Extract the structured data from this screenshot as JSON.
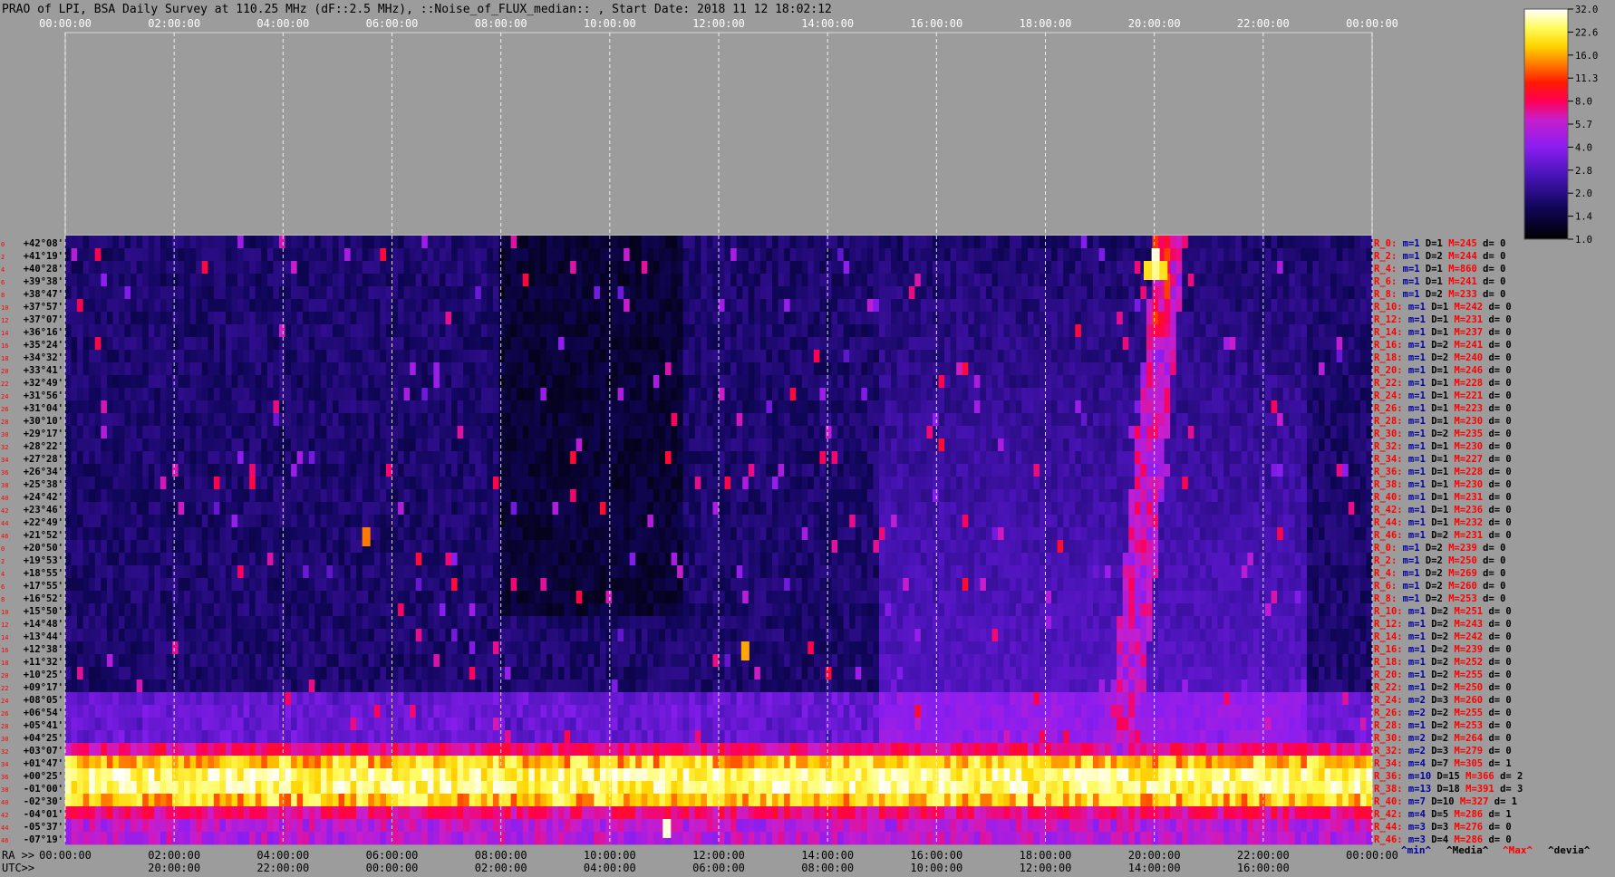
{
  "chart_data": {
    "type": "heatmap",
    "title": "PRAO of LPI, BSA Daily Survey at 110.25 MHz (dF::2.5 MHz), ::Noise_of_FLUX_median:: , Start Date: 2018 11 12 18:02:12",
    "x_top_ticks": [
      "00:00:00",
      "02:00:00",
      "04:00:00",
      "06:00:00",
      "08:00:00",
      "10:00:00",
      "12:00:00",
      "14:00:00",
      "16:00:00",
      "18:00:00",
      "20:00:00",
      "22:00:00",
      "00:00:00"
    ],
    "x_ra_label": "RA >>",
    "x_ra_ticks": [
      "00:00:00",
      "02:00:00",
      "04:00:00",
      "06:00:00",
      "08:00:00",
      "10:00:00",
      "12:00:00",
      "14:00:00",
      "16:00:00",
      "18:00:00",
      "20:00:00",
      "22:00:00",
      "00:00:00"
    ],
    "x_utc_label": "UTC>>",
    "x_utc_ticks": [
      "20:00:00",
      "22:00:00",
      "00:00:00",
      "02:00:00",
      "04:00:00",
      "06:00:00",
      "08:00:00",
      "10:00:00",
      "12:00:00",
      "14:00:00",
      "16:00:00"
    ],
    "y_left_ticks": [
      "+42°08'",
      "+41°19'",
      "+40°28'",
      "+39°38'",
      "+38°47'",
      "+37°57'",
      "+37°07'",
      "+36°16'",
      "+35°24'",
      "+34°32'",
      "+33°41'",
      "+32°49'",
      "+31°56'",
      "+31°04'",
      "+30°10'",
      "+29°17'",
      "+28°22'",
      "+27°28'",
      "+26°34'",
      "+25°38'",
      "+24°42'",
      "+23°46'",
      "+22°49'",
      "+21°52'",
      "+20°50'",
      "+19°53'",
      "+18°55'",
      "+17°55'",
      "+16°52'",
      "+15°50'",
      "+14°48'",
      "+13°44'",
      "+12°38'",
      "+11°32'",
      "+10°25'",
      "+09°17'",
      "+08°05'",
      "+06°54'",
      "+05°41'",
      "+04°25'",
      "+03°07'",
      "+01°47'",
      "+00°25'",
      "-01°00'",
      "-02°30'",
      "-04°01'",
      "-05°37'",
      "-07°19'"
    ],
    "y_ray_numbers": [
      "0",
      "2",
      "4",
      "6",
      "8",
      "10",
      "12",
      "14",
      "16",
      "18",
      "20",
      "22",
      "24",
      "26",
      "28",
      "30",
      "32",
      "34",
      "36",
      "38",
      "40",
      "42",
      "44",
      "46",
      "0",
      "2",
      "4",
      "6",
      "8",
      "10",
      "12",
      "14",
      "16",
      "18",
      "20",
      "22",
      "24",
      "26",
      "28",
      "30",
      "32",
      "34",
      "36",
      "38",
      "40",
      "42",
      "44",
      "46"
    ],
    "right_stats": [
      {
        "ray": "R_0:",
        "m": "m=1",
        "D": "D=1",
        "M": "M=245",
        "d": "d= 0"
      },
      {
        "ray": "R_2:",
        "m": "m=1",
        "D": "D=2",
        "M": "M=244",
        "d": "d= 0"
      },
      {
        "ray": "R_4:",
        "m": "m=1",
        "D": "D=1",
        "M": "M=860",
        "d": "d= 0"
      },
      {
        "ray": "R_6:",
        "m": "m=1",
        "D": "D=1",
        "M": "M=241",
        "d": "d= 0"
      },
      {
        "ray": "R_8:",
        "m": "m=1",
        "D": "D=2",
        "M": "M=233",
        "d": "d= 0"
      },
      {
        "ray": "R_10:",
        "m": "m=1",
        "D": "D=1",
        "M": "M=242",
        "d": "d= 0"
      },
      {
        "ray": "R_12:",
        "m": "m=1",
        "D": "D=1",
        "M": "M=231",
        "d": "d= 0"
      },
      {
        "ray": "R_14:",
        "m": "m=1",
        "D": "D=1",
        "M": "M=237",
        "d": "d= 0"
      },
      {
        "ray": "R_16:",
        "m": "m=1",
        "D": "D=2",
        "M": "M=241",
        "d": "d= 0"
      },
      {
        "ray": "R_18:",
        "m": "m=1",
        "D": "D=2",
        "M": "M=240",
        "d": "d= 0"
      },
      {
        "ray": "R_20:",
        "m": "m=1",
        "D": "D=1",
        "M": "M=246",
        "d": "d= 0"
      },
      {
        "ray": "R_22:",
        "m": "m=1",
        "D": "D=1",
        "M": "M=228",
        "d": "d= 0"
      },
      {
        "ray": "R_24:",
        "m": "m=1",
        "D": "D=1",
        "M": "M=221",
        "d": "d= 0"
      },
      {
        "ray": "R_26:",
        "m": "m=1",
        "D": "D=1",
        "M": "M=223",
        "d": "d= 0"
      },
      {
        "ray": "R_28:",
        "m": "m=1",
        "D": "D=1",
        "M": "M=230",
        "d": "d= 0"
      },
      {
        "ray": "R_30:",
        "m": "m=1",
        "D": "D=2",
        "M": "M=235",
        "d": "d= 0"
      },
      {
        "ray": "R_32:",
        "m": "m=1",
        "D": "D=1",
        "M": "M=230",
        "d": "d= 0"
      },
      {
        "ray": "R_34:",
        "m": "m=1",
        "D": "D=1",
        "M": "M=227",
        "d": "d= 0"
      },
      {
        "ray": "R_36:",
        "m": "m=1",
        "D": "D=1",
        "M": "M=228",
        "d": "d= 0"
      },
      {
        "ray": "R_38:",
        "m": "m=1",
        "D": "D=1",
        "M": "M=230",
        "d": "d= 0"
      },
      {
        "ray": "R_40:",
        "m": "m=1",
        "D": "D=1",
        "M": "M=231",
        "d": "d= 0"
      },
      {
        "ray": "R_42:",
        "m": "m=1",
        "D": "D=1",
        "M": "M=236",
        "d": "d= 0"
      },
      {
        "ray": "R_44:",
        "m": "m=1",
        "D": "D=1",
        "M": "M=232",
        "d": "d= 0"
      },
      {
        "ray": "R_46:",
        "m": "m=1",
        "D": "D=2",
        "M": "M=231",
        "d": "d= 0"
      },
      {
        "ray": "R_0:",
        "m": "m=1",
        "D": "D=2",
        "M": "M=239",
        "d": "d= 0"
      },
      {
        "ray": "R_2:",
        "m": "m=1",
        "D": "D=2",
        "M": "M=250",
        "d": "d= 0"
      },
      {
        "ray": "R_4:",
        "m": "m=1",
        "D": "D=2",
        "M": "M=269",
        "d": "d= 0"
      },
      {
        "ray": "R_6:",
        "m": "m=1",
        "D": "D=2",
        "M": "M=260",
        "d": "d= 0"
      },
      {
        "ray": "R_8:",
        "m": "m=1",
        "D": "D=2",
        "M": "M=253",
        "d": "d= 0"
      },
      {
        "ray": "R_10:",
        "m": "m=1",
        "D": "D=2",
        "M": "M=251",
        "d": "d= 0"
      },
      {
        "ray": "R_12:",
        "m": "m=1",
        "D": "D=2",
        "M": "M=243",
        "d": "d= 0"
      },
      {
        "ray": "R_14:",
        "m": "m=1",
        "D": "D=2",
        "M": "M=242",
        "d": "d= 0"
      },
      {
        "ray": "R_16:",
        "m": "m=1",
        "D": "D=2",
        "M": "M=239",
        "d": "d= 0"
      },
      {
        "ray": "R_18:",
        "m": "m=1",
        "D": "D=2",
        "M": "M=252",
        "d": "d= 0"
      },
      {
        "ray": "R_20:",
        "m": "m=1",
        "D": "D=2",
        "M": "M=255",
        "d": "d= 0"
      },
      {
        "ray": "R_22:",
        "m": "m=1",
        "D": "D=2",
        "M": "M=250",
        "d": "d= 0"
      },
      {
        "ray": "R_24:",
        "m": "m=2",
        "D": "D=3",
        "M": "M=260",
        "d": "d= 0"
      },
      {
        "ray": "R_26:",
        "m": "m=2",
        "D": "D=2",
        "M": "M=255",
        "d": "d= 0"
      },
      {
        "ray": "R_28:",
        "m": "m=1",
        "D": "D=2",
        "M": "M=253",
        "d": "d= 0"
      },
      {
        "ray": "R_30:",
        "m": "m=2",
        "D": "D=2",
        "M": "M=264",
        "d": "d= 0"
      },
      {
        "ray": "R_32:",
        "m": "m=2",
        "D": "D=3",
        "M": "M=279",
        "d": "d= 0"
      },
      {
        "ray": "R_34:",
        "m": "m=4",
        "D": "D=7",
        "M": "M=305",
        "d": "d= 1"
      },
      {
        "ray": "R_36:",
        "m": "m=10",
        "D": "D=15",
        "M": "M=366",
        "d": "d= 2"
      },
      {
        "ray": "R_38:",
        "m": "m=13",
        "D": "D=18",
        "M": "M=391",
        "d": "d= 3"
      },
      {
        "ray": "R_40:",
        "m": "m=7",
        "D": "D=10",
        "M": "M=327",
        "d": "d= 1"
      },
      {
        "ray": "R_42:",
        "m": "m=4",
        "D": "D=5",
        "M": "M=286",
        "d": "d= 1"
      },
      {
        "ray": "R_44:",
        "m": "m=3",
        "D": "D=3",
        "M": "M=276",
        "d": "d= 0"
      },
      {
        "ray": "R_46:",
        "m": "m=3",
        "D": "D=4",
        "M": "M=286",
        "d": "d= 0"
      }
    ],
    "stats_legend": [
      "^min^",
      "^Media^",
      "^Max^",
      "^devia^"
    ],
    "colorbar_ticks": [
      "32.0",
      "22.6",
      "16.0",
      "11.3",
      "8.0",
      "5.7",
      "4.0",
      "2.8",
      "2.0",
      "1.4",
      "1.0"
    ],
    "colorbar_range": [
      1.0,
      32.0
    ],
    "colorbar_scale": "log",
    "colors": {
      "background": "#9c9c9c",
      "stat_min": "#0000a0",
      "stat_max": "#ff0000",
      "text": "#000000",
      "ray_numbers": "#ff0000"
    }
  }
}
